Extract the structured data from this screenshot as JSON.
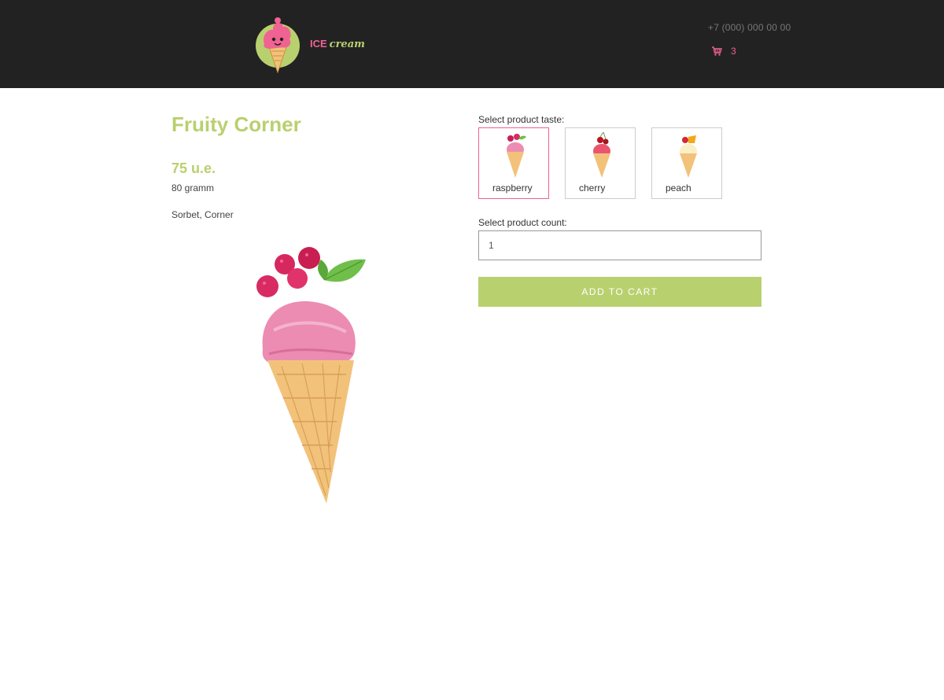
{
  "header": {
    "logo": {
      "word1": "ICE",
      "word2": "cream",
      "icon": "ice-cream-mascot-icon"
    },
    "phone": "+7 (000) 000 00 00",
    "cart": {
      "icon": "cart-icon",
      "count": "3"
    }
  },
  "product": {
    "title": "Fruity Corner",
    "price": "75 u.e.",
    "weight": "80 gramm",
    "tags": "Sorbet, Corner"
  },
  "taste": {
    "label": "Select product taste:",
    "options": [
      {
        "name": "raspberry",
        "selected": true
      },
      {
        "name": "cherry",
        "selected": false
      },
      {
        "name": "peach",
        "selected": false
      }
    ]
  },
  "count": {
    "label": "Select product count:",
    "value": "1"
  },
  "actions": {
    "add_to_cart": "ADD TO CART"
  },
  "colors": {
    "header_bg": "#222222",
    "accent_green": "#b9d06f",
    "accent_pink": "#f06292"
  }
}
